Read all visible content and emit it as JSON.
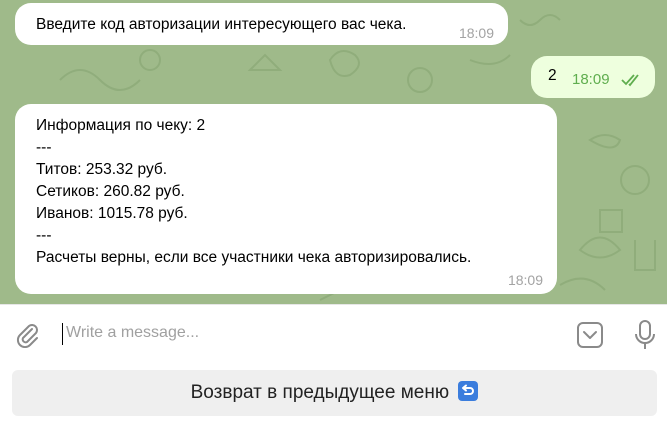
{
  "messages": [
    {
      "direction": "incoming",
      "text": "Введите код авторизации интересующего вас чека.",
      "time": "18:09"
    },
    {
      "direction": "outgoing",
      "text": "2",
      "time": "18:09",
      "status": "read"
    },
    {
      "direction": "incoming",
      "lines": [
        "Информация по чеку: 2",
        "---",
        "Титов: 253.32 руб.",
        "Сетиков: 260.82 руб.",
        "Иванов: 1015.78 руб.",
        "---",
        "Расчеты верны, если все участники чека авторизировались."
      ],
      "time": "18:09"
    }
  ],
  "composer": {
    "placeholder": "Write a message...",
    "icons": [
      "paperclip-icon",
      "emoji-keyboard-icon",
      "microphone-icon"
    ]
  },
  "keyboard": {
    "button_label": "Возврат в предыдущее меню",
    "button_icon": "return-arrow-icon"
  },
  "colors": {
    "chat_background": "#9fba8a",
    "incoming_bubble": "#ffffff",
    "outgoing_bubble": "#eeffde",
    "outgoing_time": "#5fae4e",
    "keyboard_button": "#efefef",
    "return_icon": "#3b7ddd"
  }
}
